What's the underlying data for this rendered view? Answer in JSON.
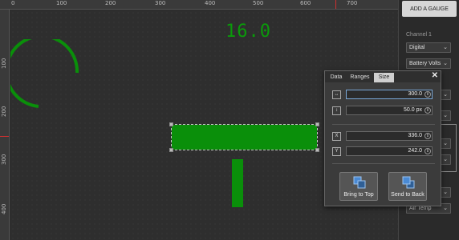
{
  "ruler": {
    "top_ticks": [
      "0",
      "100",
      "200",
      "300",
      "400",
      "500",
      "600",
      "700"
    ],
    "left_ticks": [
      "100",
      "200",
      "300",
      "400"
    ]
  },
  "canvas": {
    "digital_readout": "16.0",
    "gauge_color": "#0a8f0a"
  },
  "right_panel": {
    "add_gauge_label": "ADD A GAUGE",
    "channel_label": "Channel 1",
    "selects": [
      {
        "value": "Digital"
      },
      {
        "value": "Battery Volts"
      },
      {
        "value": ""
      },
      {
        "value": ""
      },
      {
        "value": ""
      },
      {
        "value": ""
      },
      {
        "value": ""
      },
      {
        "value": "Air Temp"
      }
    ]
  },
  "dialog": {
    "tabs": [
      {
        "label": "Data"
      },
      {
        "label": "Ranges"
      },
      {
        "label": "Size",
        "active": true
      }
    ],
    "close_label": "✕",
    "width_value": "300.0",
    "height_value": "50.0 px",
    "x_label": "X",
    "x_value": "336.0",
    "y_label": "Y",
    "y_value": "242.0",
    "bring_to_top_label": "Bring to Top",
    "send_to_back_label": "Send to Back"
  },
  "colors": {
    "accent_green": "#0a8f0a",
    "button_blue": "#4a8ad4",
    "marker_red": "#d03030"
  }
}
